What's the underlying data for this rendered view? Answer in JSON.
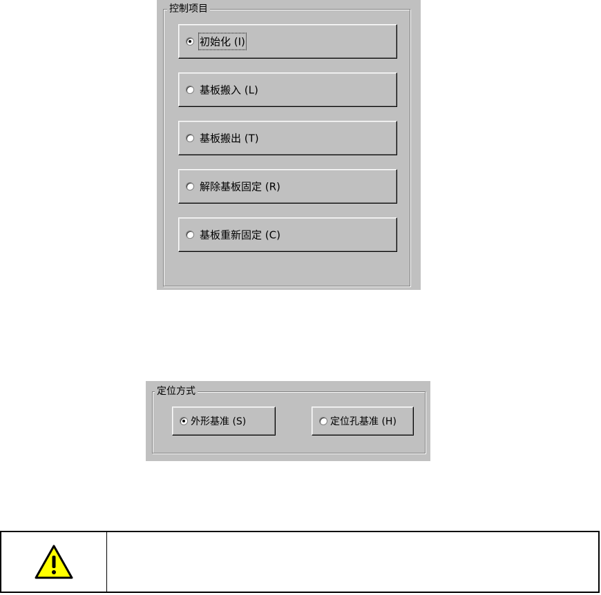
{
  "control_panel": {
    "title": "控制项目",
    "items": [
      {
        "label": "初始化 (I)",
        "checked": true
      },
      {
        "label": "基板搬入 (L)",
        "checked": false
      },
      {
        "label": "基板搬出 (T)",
        "checked": false
      },
      {
        "label": "解除基板固定 (R)",
        "checked": false
      },
      {
        "label": "基板重新固定 (C)",
        "checked": false
      }
    ]
  },
  "positioning_panel": {
    "title": "定位方式",
    "items": [
      {
        "label": "外形基准 (S)",
        "checked": true
      },
      {
        "label": "定位孔基准 (H)",
        "checked": false
      }
    ]
  },
  "warning": {
    "icon": "warning-triangle-icon",
    "text": "",
    "colors": {
      "fill": "#ffff00",
      "stroke": "#000000"
    }
  }
}
